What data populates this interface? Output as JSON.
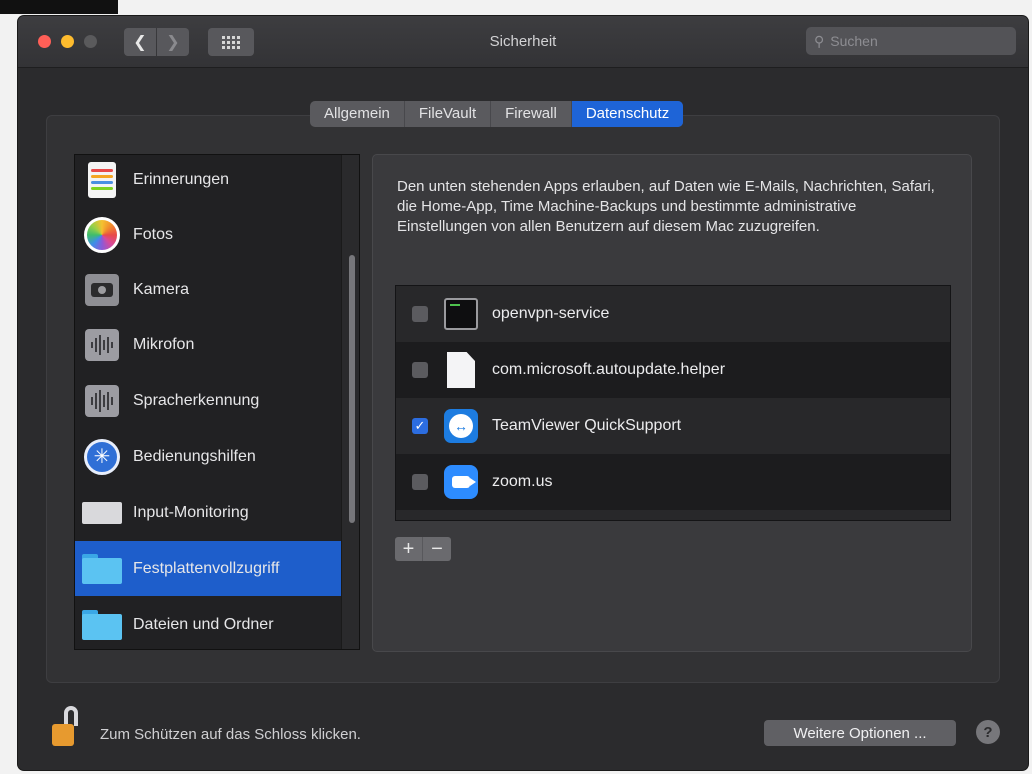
{
  "window": {
    "title": "Sicherheit",
    "search_placeholder": "Suchen"
  },
  "tabs": [
    {
      "label": "Allgemein",
      "active": false
    },
    {
      "label": "FileVault",
      "active": false
    },
    {
      "label": "Firewall",
      "active": false
    },
    {
      "label": "Datenschutz",
      "active": true
    }
  ],
  "sidebar": {
    "items": [
      {
        "label": "Erinnerungen",
        "icon": "reminders-icon"
      },
      {
        "label": "Fotos",
        "icon": "photos-icon"
      },
      {
        "label": "Kamera",
        "icon": "camera-icon"
      },
      {
        "label": "Mikrofon",
        "icon": "microphone-icon"
      },
      {
        "label": "Spracherkennung",
        "icon": "speech-recognition-icon"
      },
      {
        "label": "Bedienungshilfen",
        "icon": "accessibility-icon"
      },
      {
        "label": "Input-Monitoring",
        "icon": "keyboard-icon"
      },
      {
        "label": "Festplattenvollzugriff",
        "icon": "folder-icon",
        "selected": true
      },
      {
        "label": "Dateien und Ordner",
        "icon": "folder-icon"
      }
    ]
  },
  "main": {
    "description": "Den unten stehenden Apps erlauben, auf Daten wie E-Mails, Nachrichten, Safari, die Home-App, Time Machine-Backups und bestimmte administrative Einstellungen von allen Benutzern auf diesem Mac zuzugreifen.",
    "apps": [
      {
        "name": "openvpn-service",
        "checked": false,
        "icon": "terminal-icon"
      },
      {
        "name": "com.microsoft.autoupdate.helper",
        "checked": false,
        "icon": "document-icon"
      },
      {
        "name": "TeamViewer QuickSupport",
        "checked": true,
        "icon": "teamviewer-icon"
      },
      {
        "name": "zoom.us",
        "checked": false,
        "icon": "zoom-icon"
      }
    ],
    "add_label": "+",
    "remove_label": "−"
  },
  "footer": {
    "lock_text": "Zum Schützen auf das Schloss klicken.",
    "more_options_label": "Weitere Optionen ...",
    "help_label": "?"
  },
  "colors": {
    "accent": "#1e64d7",
    "lock": "#e79a2f"
  }
}
